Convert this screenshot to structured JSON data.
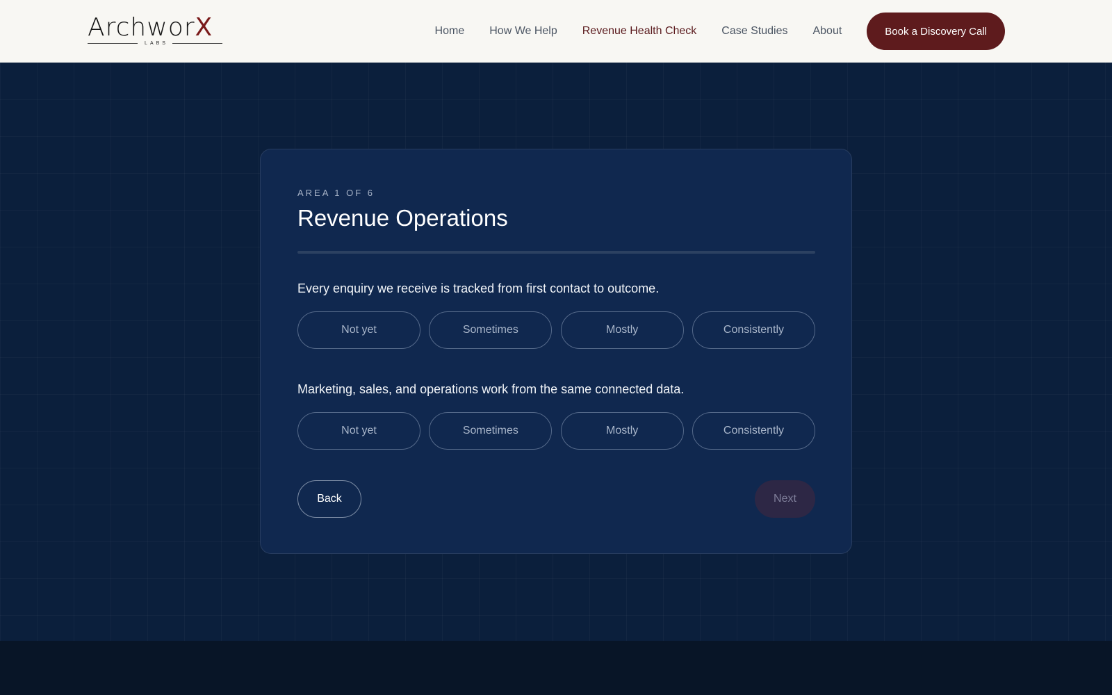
{
  "header": {
    "logo": {
      "word_main": "Archwor",
      "word_accent": "X",
      "sub": "LABS"
    },
    "nav": [
      {
        "label": "Home",
        "active": false
      },
      {
        "label": "How We Help",
        "active": false
      },
      {
        "label": "Revenue Health Check",
        "active": true
      },
      {
        "label": "Case Studies",
        "active": false
      },
      {
        "label": "About",
        "active": false
      }
    ],
    "cta_label": "Book a Discovery Call"
  },
  "card": {
    "eyebrow": "AREA 1 OF 6",
    "title": "Revenue Operations",
    "progress_fraction": 0,
    "questions": [
      {
        "text": "Every enquiry we receive is tracked from first contact to outcome.",
        "options": [
          "Not yet",
          "Sometimes",
          "Mostly",
          "Consistently"
        ]
      },
      {
        "text": "Marketing, sales, and operations work from the same connected data.",
        "options": [
          "Not yet",
          "Sometimes",
          "Mostly",
          "Consistently"
        ]
      }
    ],
    "back_label": "Back",
    "next_label": "Next"
  },
  "colors": {
    "header_bg": "#f8f7f3",
    "page_bg": "#0b1f3c",
    "card_bg": "#10284f",
    "accent": "#5e1b1d",
    "nav_active": "#5a1a1d"
  }
}
